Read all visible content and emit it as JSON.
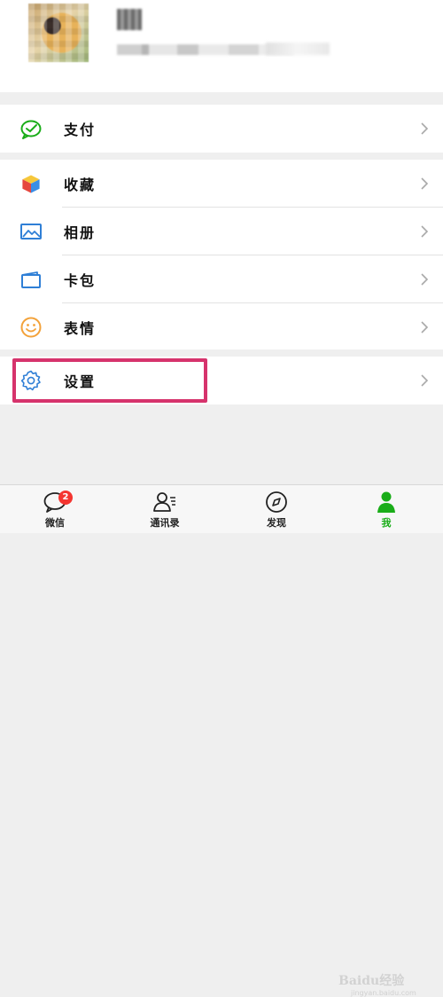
{
  "menu": {
    "pay": "支付",
    "favorites": "收藏",
    "album": "相册",
    "cards": "卡包",
    "stickers": "表情",
    "settings": "设置"
  },
  "tabbar": {
    "chats": "微信",
    "chats_badge": "2",
    "contacts": "通讯录",
    "discover": "发现",
    "me": "我",
    "active": "me"
  },
  "colors": {
    "accent_green": "#1aad19",
    "badge_red": "#f43530",
    "highlight": "#d6336c",
    "icon_blue": "#2f7fd6"
  },
  "watermark": {
    "text": "Baidu经验",
    "sub": "jingyan.baidu.com"
  }
}
